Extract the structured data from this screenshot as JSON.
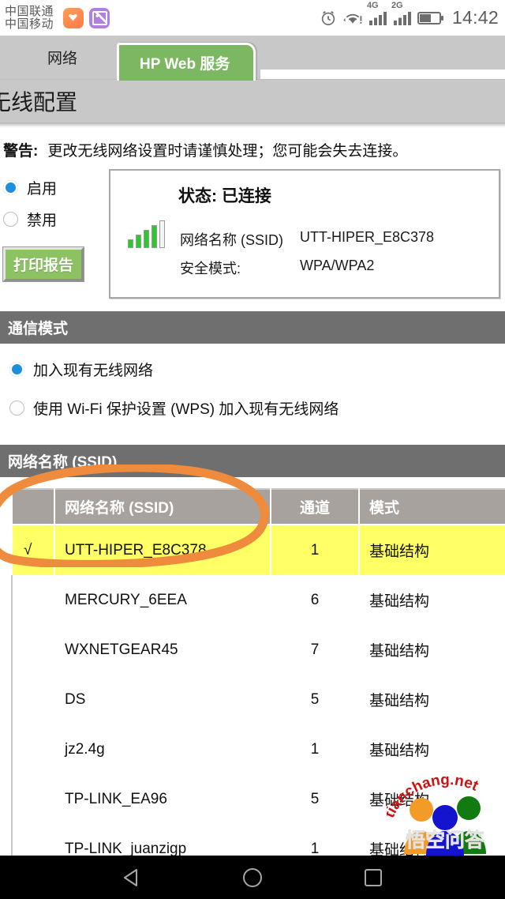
{
  "statusbar": {
    "carrier_line1": "中国联通",
    "carrier_line2": "中国移动",
    "app_icons": [
      "health-app-icon",
      "screenshot-app-icon"
    ],
    "alarm_icon": "alarm-clock-icon",
    "wifi_icon": "wifi-warning-icon",
    "sim1_label": "4G",
    "sim2_label": "2G",
    "battery_icon": "battery-icon",
    "clock": "14:42"
  },
  "tabs": [
    {
      "label": "网络",
      "active": false
    },
    {
      "label": "HP Web 服务",
      "active": true
    }
  ],
  "page_title": "无线配置",
  "warning": {
    "label": "警告:",
    "text": "更改无线网络设置时请谨慎处理；您可能会失去连接。"
  },
  "radio_group": {
    "enable_label": "启用",
    "disable_label": "禁用",
    "selected": "启用"
  },
  "print_button": "打印报告",
  "status_panel": {
    "title": "状态: 已连接",
    "signal_icon": "signal-bars-icon",
    "signal_bars": 4,
    "ssid_key": "网络名称 (SSID)",
    "ssid_value": "UTT-HIPER_E8C378",
    "security_key": "安全模式:",
    "security_value": "WPA/WPA2"
  },
  "comm_mode": {
    "section_title": "通信模式",
    "options": [
      {
        "label": "加入现有无线网络",
        "selected": true
      },
      {
        "label": "使用 Wi-Fi 保护设置 (WPS) 加入现有无线网络",
        "selected": false
      }
    ]
  },
  "ssid_section_title": "网络名称 (SSID)",
  "table": {
    "headers": [
      "",
      "网络名称 (SSID)",
      "通道",
      "模式"
    ],
    "rows": [
      {
        "check": "√",
        "name": "UTT-HIPER_E8C378",
        "channel": "1",
        "mode": "基础结构",
        "selected": true
      },
      {
        "check": "",
        "name": "MERCURY_6EEA",
        "channel": "6",
        "mode": "基础结构",
        "selected": false
      },
      {
        "check": "",
        "name": "WXNETGEAR45",
        "channel": "7",
        "mode": "基础结构",
        "selected": false
      },
      {
        "check": "",
        "name": "DS",
        "channel": "5",
        "mode": "基础结构",
        "selected": false
      },
      {
        "check": "",
        "name": "jz2.4g",
        "channel": "1",
        "mode": "基础结构",
        "selected": false
      },
      {
        "check": "",
        "name": "TP-LINK_EA96",
        "channel": "5",
        "mode": "基础结构",
        "selected": false
      },
      {
        "check": "",
        "name": "TP-LINK_juanzigp",
        "channel": "1",
        "mode": "基础结构",
        "selected": false
      }
    ]
  },
  "annotation": {
    "shape": "orange-circle-highlight",
    "color": "#ef8b3c"
  },
  "watermark": {
    "url_text": "tianchang.net",
    "brand_text": "悟空问答"
  },
  "navbar": {
    "back": "back-icon",
    "home": "home-icon",
    "recents": "recents-icon"
  },
  "colors": {
    "tab_active": "#7cb862",
    "section_bar": "#6f6f6f",
    "table_header": "#a8a29e",
    "row_highlight": "#ffff66",
    "radio_on": "#1d8fe0",
    "chrome_gray": "#c8c8c8"
  }
}
